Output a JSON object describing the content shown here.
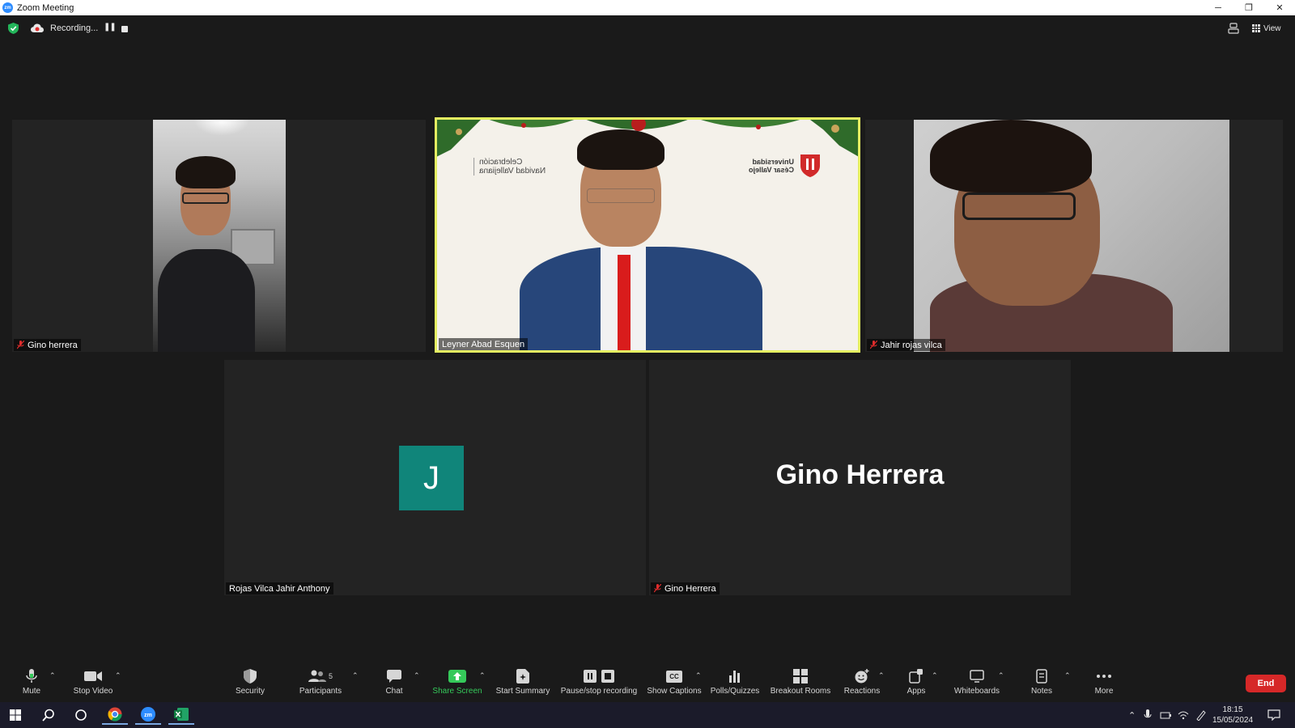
{
  "window": {
    "title": "Zoom Meeting",
    "logo_text": "zm",
    "controls": {
      "minimize": "─",
      "restore": "❐",
      "close": "✕"
    }
  },
  "topbar": {
    "recording_label": "Recording...",
    "pause_symbol": "❚❚",
    "view_label": "View"
  },
  "participants_tiles": [
    {
      "name": "Gino herrera",
      "muted": true,
      "video": true
    },
    {
      "name": "Leyner Abad Esquen",
      "muted": false,
      "video": true,
      "active_speaker": true
    },
    {
      "name": "Jahir rojas vilca",
      "muted": true,
      "video": true
    },
    {
      "name": "Rojas Vilca Jahir Anthony",
      "muted": false,
      "video": false,
      "avatar_letter": "J",
      "avatar_color": "#10857a"
    },
    {
      "name": "Gino Herrera",
      "muted": true,
      "video": false,
      "display_name": "Gino Herrera"
    }
  ],
  "speaker_background": {
    "left_text_line1": "Celebración",
    "left_text_line2": "Navidad Vallejiana",
    "right_text_line1": "Universidad",
    "right_text_line2": "César Vallejo"
  },
  "toolbar": {
    "mute": "Mute",
    "stop_video": "Stop Video",
    "security": "Security",
    "participants": "Participants",
    "participants_count": "5",
    "chat": "Chat",
    "share_screen": "Share Screen",
    "start_summary": "Start Summary",
    "pause_stop_recording": "Pause/stop recording",
    "show_captions": "Show Captions",
    "captions_icon_text": "CC",
    "polls": "Polls/Quizzes",
    "breakout_rooms": "Breakout Rooms",
    "reactions": "Reactions",
    "apps": "Apps",
    "whiteboards": "Whiteboards",
    "notes": "Notes",
    "more": "More",
    "end": "End"
  },
  "colors": {
    "meeting_bg": "#1a1a1a",
    "tile_bg": "#232323",
    "active_speaker_border": "#e4ef61",
    "share_green": "#35c95a",
    "end_red": "#d62828",
    "zoom_blue": "#2d8cff"
  },
  "taskbar": {
    "time": "18:15",
    "date": "15/05/2024",
    "apps": [
      "windows-start",
      "search",
      "cortana",
      "chrome",
      "zoom",
      "excel"
    ]
  }
}
